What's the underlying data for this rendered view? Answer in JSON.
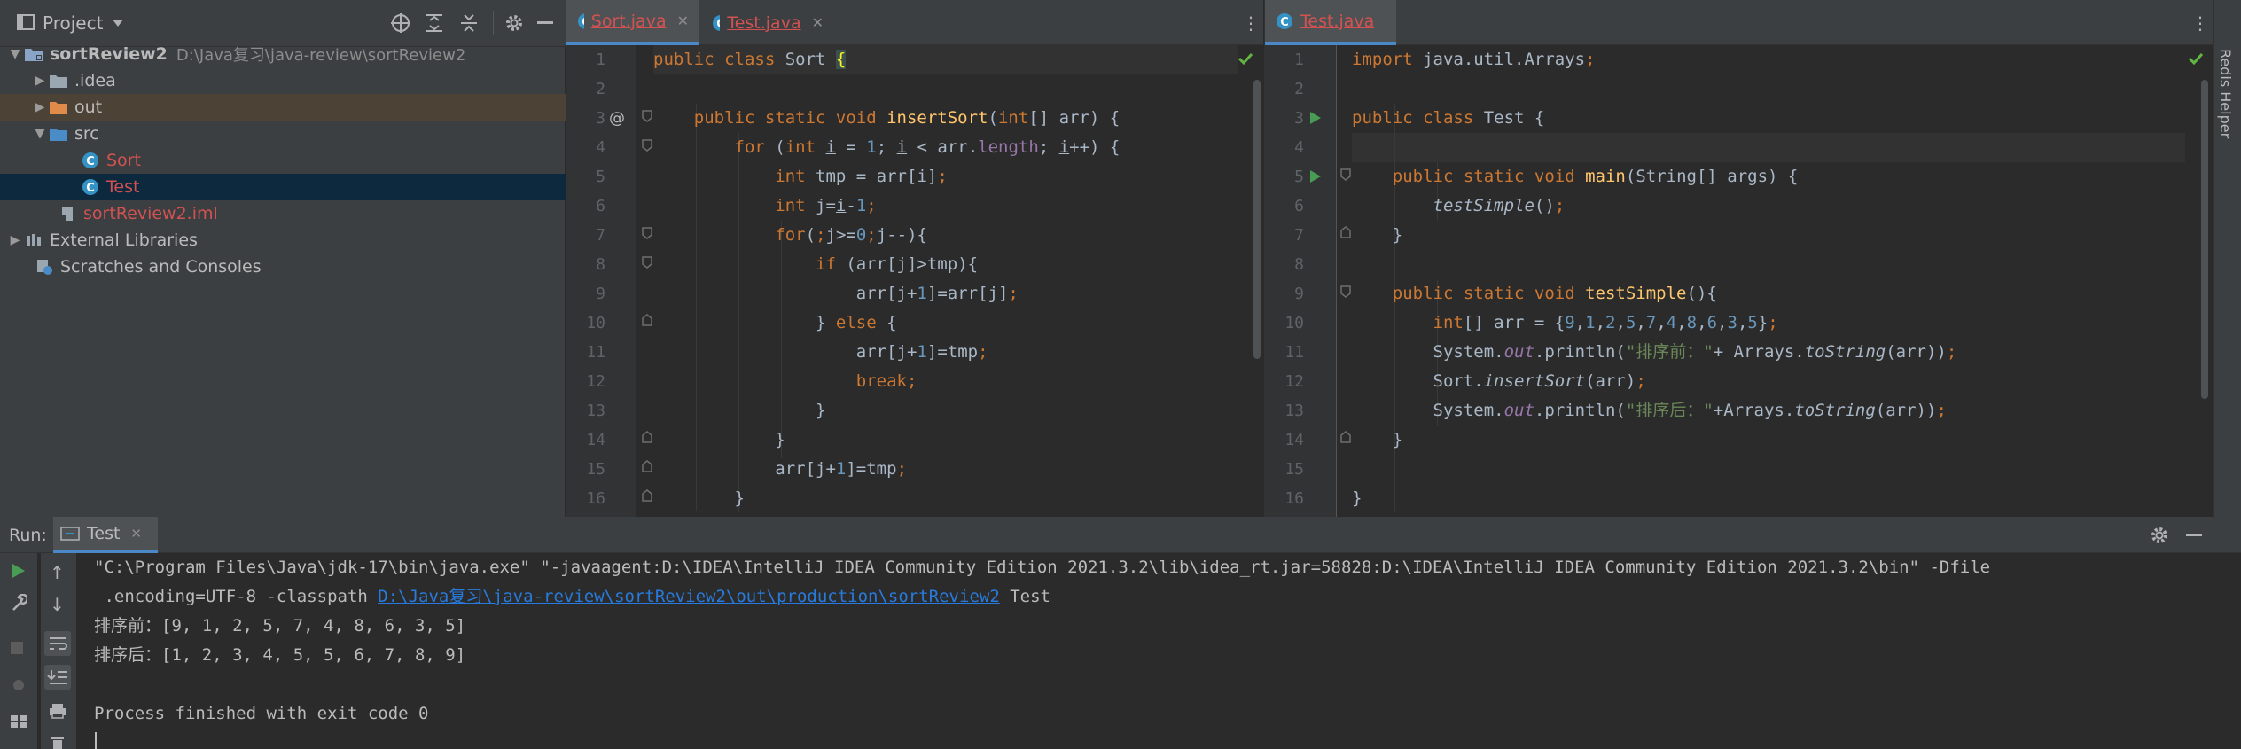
{
  "project": {
    "title": "Project",
    "tree": [
      {
        "name": "sortReview2",
        "path": "D:\\Java复习\\java-review\\sortReview2"
      },
      {
        "name": ".idea"
      },
      {
        "name": "out"
      },
      {
        "name": "src"
      },
      {
        "name": "Sort"
      },
      {
        "name": "Test"
      },
      {
        "name": "sortReview2.iml"
      },
      {
        "name": "External Libraries"
      },
      {
        "name": "Scratches and Consoles"
      }
    ]
  },
  "editor_left": {
    "tabs": [
      {
        "label": "Sort.java"
      },
      {
        "label": "Test.java"
      }
    ],
    "line_numbers": [
      "1",
      "2",
      "3",
      "4",
      "5",
      "6",
      "7",
      "8",
      "9",
      "10",
      "11",
      "12",
      "13",
      "14",
      "15",
      "16"
    ],
    "gutter_marker": "@"
  },
  "editor_right": {
    "tabs": [
      {
        "label": "Test.java"
      }
    ],
    "line_numbers": [
      "1",
      "2",
      "3",
      "4",
      "5",
      "6",
      "7",
      "8",
      "9",
      "10",
      "11",
      "12",
      "13",
      "14",
      "15",
      "16"
    ]
  },
  "right_strip": {
    "label": "Redis Helper"
  },
  "run": {
    "label": "Run:",
    "tab": "Test",
    "console": {
      "cmd1": "\"C:\\Program Files\\Java\\jdk-17\\bin\\java.exe\" \"-javaagent:D:\\IDEA\\IntelliJ IDEA Community Edition 2021.3.2\\lib\\idea_rt.jar=58828:D:\\IDEA\\IntelliJ IDEA Community Edition 2021.3.2\\bin\" -Dfile",
      "cmd2_prefix": " .encoding=UTF-8 -classpath ",
      "cmd2_link": "D:\\Java复习\\java-review\\sortReview2\\out\\production\\sortReview2",
      "cmd2_suffix": " Test",
      "before": "排序前：[9, 1, 2, 5, 7, 4, 8, 6, 3, 5]",
      "after": "排序后：[1, 2, 3, 4, 5, 5, 6, 7, 8, 9]",
      "exit": "Process finished with exit code 0"
    }
  },
  "colors": {
    "accent": "#4a88c7",
    "keyword": "#cc7832",
    "function": "#ffc66d",
    "number": "#6897bb",
    "string": "#6a8759",
    "field": "#9876aa",
    "link": "#287bde",
    "error_file": "#d25252"
  }
}
